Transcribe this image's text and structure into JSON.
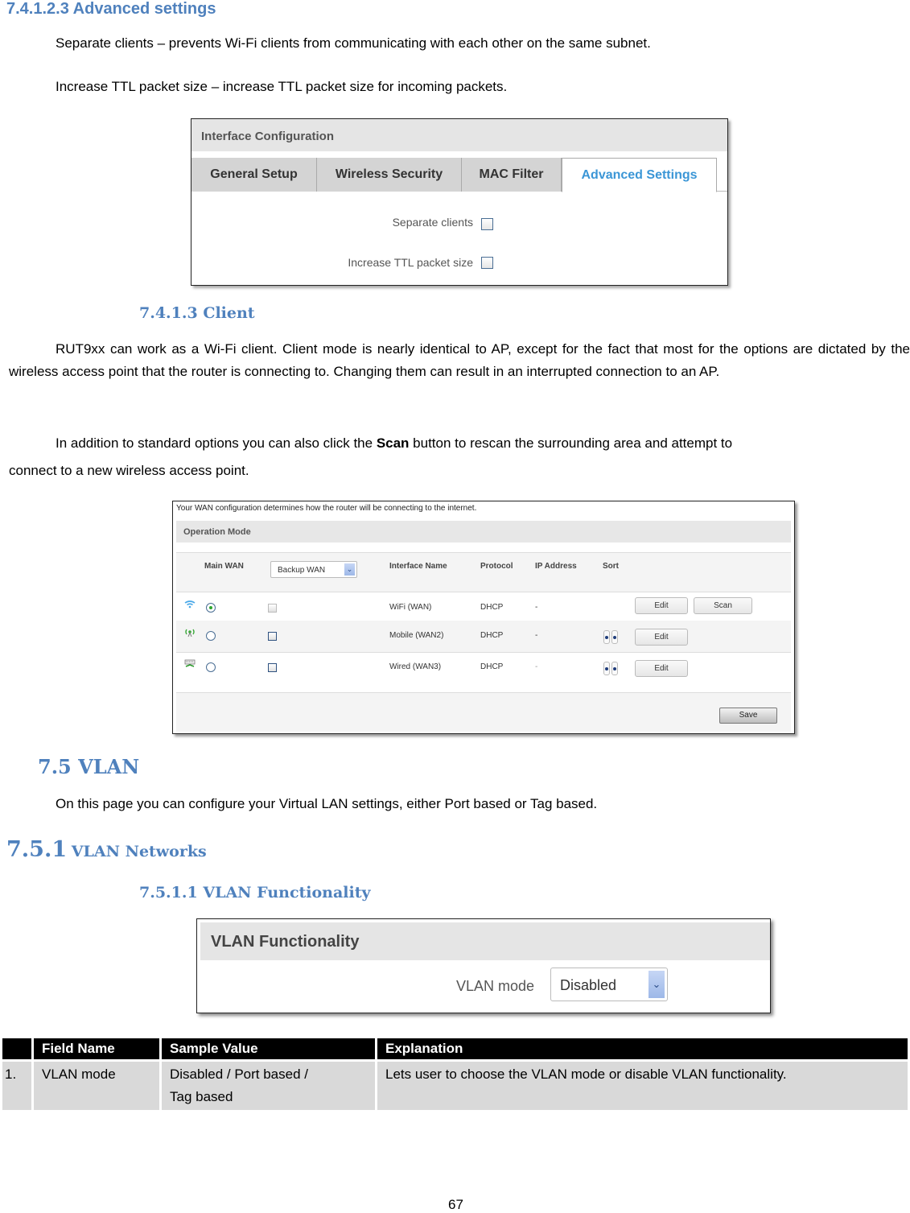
{
  "sections": {
    "advanced_settings": {
      "heading": "7.4.1.2.3   Advanced settings",
      "para1": "Separate clients – prevents Wi-Fi clients from communicating with each other on the same subnet.",
      "para2": "Increase TTL packet size – increase TTL packet size for incoming packets."
    },
    "client": {
      "heading": "7.4.1.3    Client",
      "para1": "RUT9xx can work as a Wi-Fi client. Client mode is nearly identical to AP, except for the fact that most for the options are dictated by the wireless access point that the router is connecting to. Changing them can result in an interrupted connection to an AP.",
      "para2_pre": "In addition to standard options you can also click the ",
      "para2_bold": "Scan",
      "para2_post": " button to rescan the surrounding area and attempt to",
      "para2_line2": "connect to a new wireless access point."
    },
    "vlan": {
      "heading": "7.5    VLAN",
      "para1": "On this page you can configure your Virtual LAN settings, either Port based or Tag based."
    },
    "vlan_networks": {
      "heading_num": "7.5.1",
      "heading_text": "VLAN Networks"
    },
    "vlan_functionality": {
      "heading": "7.5.1.1    VLAN Functionality"
    }
  },
  "interface_config": {
    "title": "Interface Configuration",
    "tabs": [
      {
        "label": "General Setup",
        "active": false
      },
      {
        "label": "Wireless Security",
        "active": false
      },
      {
        "label": "MAC Filter",
        "active": false
      },
      {
        "label": "Advanced Settings",
        "active": true
      }
    ],
    "fields": [
      {
        "label": "Separate clients",
        "checked": false
      },
      {
        "label": "Increase TTL packet size",
        "checked": false
      }
    ]
  },
  "wan_config": {
    "intro": "Your WAN configuration determines how the router will be connecting to the internet.",
    "section_title": "Operation Mode",
    "columns": {
      "main_wan": "Main WAN",
      "backup_select": "Backup WAN",
      "interface_name": "Interface Name",
      "protocol": "Protocol",
      "ip_address": "IP Address",
      "sort": "Sort"
    },
    "rows": [
      {
        "icon": "wifi-icon",
        "main": true,
        "backup_checked": false,
        "backup_disabled": true,
        "interface": "WiFi (WAN)",
        "protocol": "DHCP",
        "ip": "-",
        "sortable": false,
        "edit_label": "Edit",
        "scan_label": "Scan"
      },
      {
        "icon": "mobile-antenna-icon",
        "main": false,
        "backup_checked": false,
        "backup_disabled": false,
        "interface": "Mobile (WAN2)",
        "protocol": "DHCP",
        "ip": "-",
        "sortable": true,
        "edit_label": "Edit"
      },
      {
        "icon": "wired-ethernet-icon",
        "main": false,
        "backup_checked": false,
        "backup_disabled": false,
        "interface": "Wired (WAN3)",
        "protocol": "DHCP",
        "ip": "-",
        "sortable": true,
        "edit_label": "Edit"
      }
    ],
    "save_label": "Save"
  },
  "vlan_panel": {
    "title": "VLAN Functionality",
    "mode_label": "VLAN mode",
    "mode_value": "Disabled"
  },
  "field_table": {
    "headers": [
      "",
      "Field Name",
      "Sample Value",
      "Explanation"
    ],
    "rows": [
      {
        "num": "1.",
        "field": "VLAN mode",
        "sample_line1": "Disabled / Port based /",
        "sample_line2": "Tag based",
        "explanation": "Lets user to choose the VLAN mode or disable VLAN functionality."
      }
    ]
  },
  "page_number": "67",
  "colors": {
    "heading_blue": "#4f81bd",
    "active_tab_blue": "#3b96d6",
    "table_header_bg": "#000000",
    "table_cell_bg": "#d9d9d9"
  }
}
